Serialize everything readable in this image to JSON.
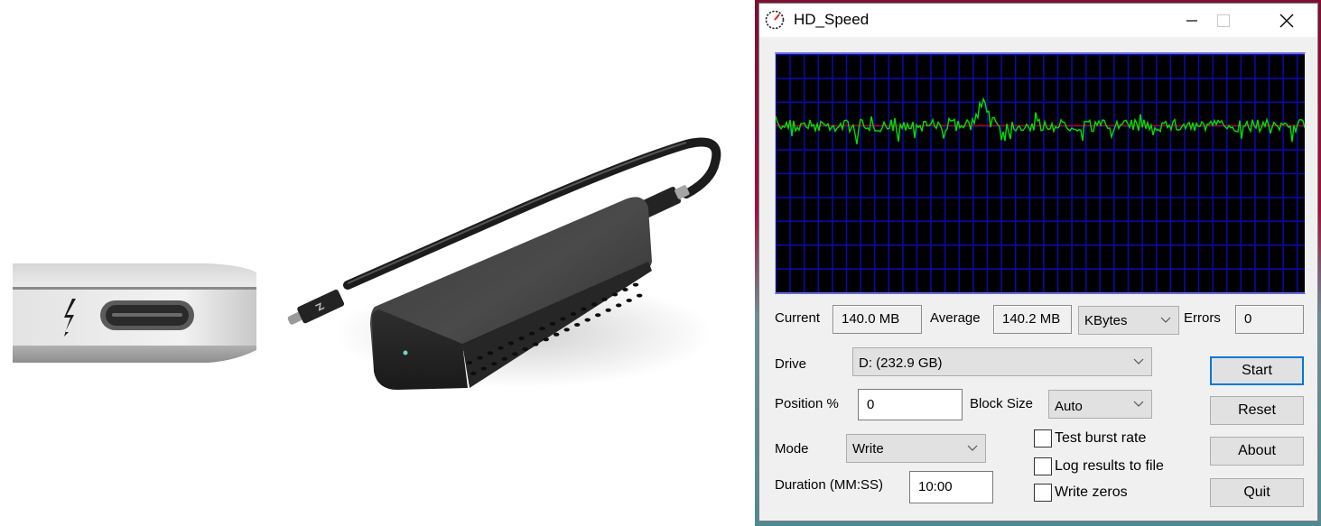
{
  "window": {
    "title": "HD_Speed",
    "controls": {
      "minimize": "minimize",
      "maximize": "maximize",
      "close": "close"
    }
  },
  "stats": {
    "current_label": "Current",
    "current_value": "140.0 MB",
    "average_label": "Average",
    "average_value": "140.2 MB",
    "unit_selected": "KBytes",
    "errors_label": "Errors",
    "errors_value": "0"
  },
  "settings": {
    "drive_label": "Drive",
    "drive_selected": "D: (232.9 GB)",
    "position_label": "Position %",
    "position_value": "0",
    "block_size_label": "Block Size",
    "block_size_selected": "Auto",
    "mode_label": "Mode",
    "mode_selected": "Write",
    "duration_label": "Duration (MM:SS)",
    "duration_value": "10:00"
  },
  "options": [
    {
      "label": "Test burst rate",
      "checked": false
    },
    {
      "label": "Log results to file",
      "checked": false
    },
    {
      "label": "Write zeros",
      "checked": false
    }
  ],
  "buttons": {
    "start": "Start",
    "reset": "Reset",
    "about": "About",
    "quit": "Quit"
  },
  "graph": {
    "background": "#000000",
    "grid_color": "#0a0aa8",
    "trace_color": "#00e000",
    "average_line_color": "#e00000",
    "average_level_fraction": 0.7,
    "peak_fraction": 0.79
  },
  "photo": {
    "subject": "laptop-thunderbolt-port-and-external-ssd-enclosure",
    "port_icon": "thunderbolt-icon"
  },
  "colors": {
    "default_button_border": "#0078d7",
    "window_bg": "#f0f0f0"
  }
}
